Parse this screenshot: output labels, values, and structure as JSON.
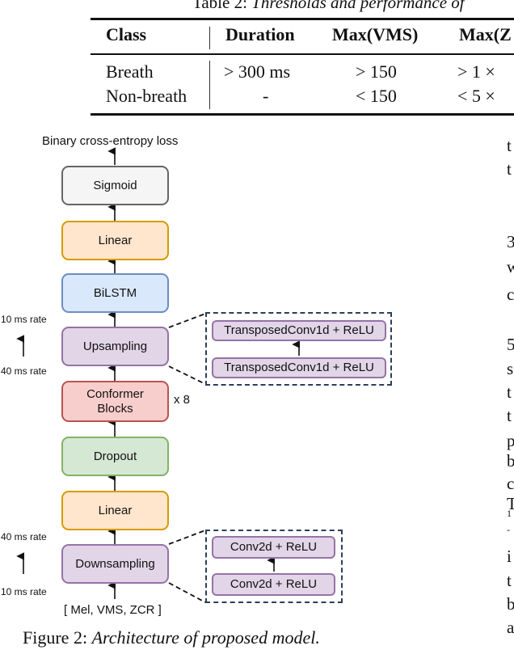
{
  "table": {
    "caption_prefix": "Table 2: ",
    "caption_italic": "Thresholds and performance of",
    "headers": [
      "Class",
      "Duration",
      "Max(VMS)",
      "Max(Z"
    ],
    "rows": [
      [
        "Breath",
        "> 300 ms",
        "> 150",
        "> 1 ×"
      ],
      [
        "Non-breath",
        "-",
        "< 150",
        "< 5 ×"
      ]
    ]
  },
  "figure": {
    "output_label": "Binary cross-entropy loss",
    "blocks": {
      "sigmoid": "Sigmoid",
      "linear_top": "Linear",
      "bilstm": "BiLSTM",
      "upsampling": "Upsampling",
      "conformer": "Conformer Blocks",
      "dropout": "Dropout",
      "linear_bottom": "Linear",
      "downsampling": "Downsampling"
    },
    "repeat_label": "x 8",
    "upsampling_detail": [
      "TransposedConv1d + ReLU",
      "TransposedConv1d + ReLU"
    ],
    "downsampling_detail": [
      "Conv2d + ReLU",
      "Conv2d + ReLU"
    ],
    "rate_labels": {
      "up_top": "10 ms rate",
      "up_bottom": "40 ms rate",
      "down_top": "40 ms rate",
      "down_bottom": "10 ms rate"
    },
    "input_label": "[ Mel, VMS, ZCR ]",
    "caption_prefix": "Figure 2: ",
    "caption_italic": "Architecture of proposed model."
  },
  "right_column_fragments": [
    "t",
    "t",
    "3",
    "w",
    "c",
    "5",
    "s",
    "t",
    "t",
    "p",
    "b",
    "c",
    "T",
    "1",
    "-",
    "i",
    "t",
    "b",
    "a"
  ],
  "colors": {
    "gray_fill": "#f5f5f5",
    "gray_stroke": "#666666",
    "orange_fill": "#ffe6cc",
    "orange_stroke": "#d79b00",
    "blue_fill": "#dae8fc",
    "blue_stroke": "#6c8ebf",
    "purple_fill": "#e1d5e7",
    "purple_stroke": "#9673a6",
    "red_fill": "#f8cecc",
    "red_stroke": "#b85450",
    "green_fill": "#d5e8d4",
    "green_stroke": "#82b366",
    "dash_stroke": "#2b3f5c"
  }
}
